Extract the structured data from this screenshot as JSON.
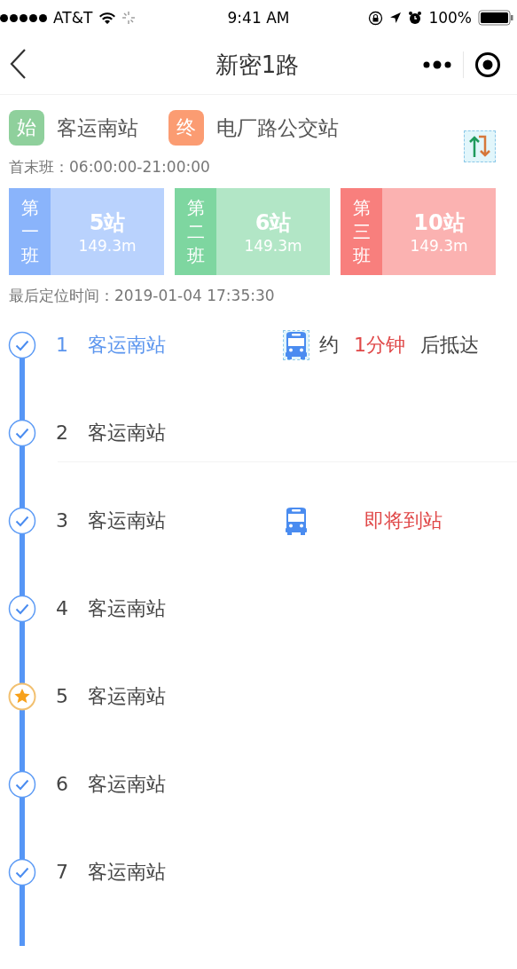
{
  "status_bar": {
    "carrier": "AT&T",
    "time": "9:41 AM",
    "battery": "100%"
  },
  "nav": {
    "title": "新密1路"
  },
  "route": {
    "start_badge": "始",
    "start": "客运南站",
    "end_badge": "终",
    "end": "电厂路公交站",
    "hours": "首末班：06:00:00-21:00:00"
  },
  "shifts": [
    {
      "label": "第一班",
      "stops": "5站",
      "distance": "149.3m",
      "color": "#8ab4fb"
    },
    {
      "label": "第二班",
      "stops": "6站",
      "distance": "149.3m",
      "color": "#7ed6a0"
    },
    {
      "label": "第三班",
      "stops": "10站",
      "distance": "149.3m",
      "color": "#f87f7d"
    }
  ],
  "last_located": "最后定位时间：2019-01-04 17:35:30",
  "stops": [
    {
      "number": "1",
      "name": "客运南站",
      "selected": true,
      "favorite": false,
      "bus": {
        "kind": "eta",
        "prefix": "约",
        "minutes": "1分钟",
        "suffix": "后抵达"
      }
    },
    {
      "number": "2",
      "name": "客运南站",
      "selected": false,
      "favorite": false
    },
    {
      "number": "3",
      "name": "客运南站",
      "selected": false,
      "favorite": false,
      "bus": {
        "kind": "arriving",
        "text": "即将到站"
      }
    },
    {
      "number": "4",
      "name": "客运南站",
      "selected": false,
      "favorite": false
    },
    {
      "number": "5",
      "name": "客运南站",
      "selected": false,
      "favorite": true
    },
    {
      "number": "6",
      "name": "客运南站",
      "selected": false,
      "favorite": false
    },
    {
      "number": "7",
      "name": "客运南站",
      "selected": false,
      "favorite": false
    }
  ]
}
